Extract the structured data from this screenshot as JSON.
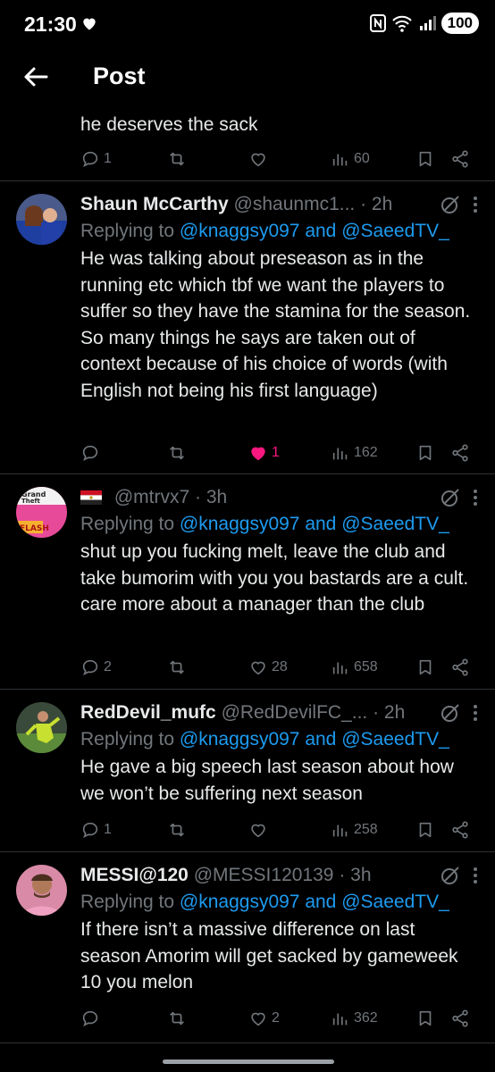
{
  "status_bar": {
    "time": "21:30",
    "battery": "100"
  },
  "header": {
    "title": "Post"
  },
  "partial_tweet": {
    "text": "he deserves the sack",
    "replies": "1",
    "retweets": "",
    "likes": "",
    "views": "60"
  },
  "tweets": [
    {
      "name": "Shaun McCarthy",
      "handle": "@shaunmc1...",
      "time": "· 2h",
      "replying_prefix": "Replying to",
      "mention1": "@knaggsy097",
      "and_word": "and",
      "mention2": "@SaeedTV_",
      "text": "He was talking about preseason as in the running etc which tbf we want the players to suffer so they have the stamina for the season. So many things he says are taken out of context because of his choice of words (with English not being his first language)",
      "replies": "",
      "retweets": "",
      "likes": "1",
      "views": "162"
    },
    {
      "name": "",
      "handle": "@mtrvx7",
      "time": "· 3h",
      "replying_prefix": "Replying to",
      "mention1": "@knaggsy097",
      "and_word": "and",
      "mention2": "@SaeedTV_",
      "text": "shut up you fucking melt, leave the club and take bumorim with you you bastards are a cult. care more about a manager than the club",
      "replies": "2",
      "retweets": "",
      "likes": "28",
      "views": "658"
    },
    {
      "name": "RedDevil_mufc",
      "handle": "@RedDevilFC_...",
      "time": "· 2h",
      "replying_prefix": "Replying to",
      "mention1": "@knaggsy097",
      "and_word": "and",
      "mention2": "@SaeedTV_",
      "text": "He gave a big speech last season about how we won’t be suffering next season",
      "replies": "1",
      "retweets": "",
      "likes": "",
      "views": "258"
    },
    {
      "name": "MESSI@120",
      "handle": "@MESSI120139",
      "time": "· 3h",
      "replying_prefix": "Replying to",
      "mention1": "@knaggsy097",
      "and_word": "and",
      "mention2": "@SaeedTV_",
      "text": "If there isn’t a massive difference on last season Amorim will get sacked by gameweek 10 you melon",
      "replies": "",
      "retweets": "",
      "likes": "2",
      "views": "362"
    }
  ],
  "colors": {
    "background": "#000000",
    "text": "#e7e9ea",
    "secondary": "#71767b",
    "link": "#1d9bf0",
    "like": "#f91880",
    "divider": "#2f3336"
  },
  "icons": [
    "back-arrow-icon",
    "reply-icon",
    "retweet-icon",
    "like-icon",
    "views-icon",
    "bookmark-icon",
    "share-icon",
    "grok-icon",
    "more-icon"
  ]
}
